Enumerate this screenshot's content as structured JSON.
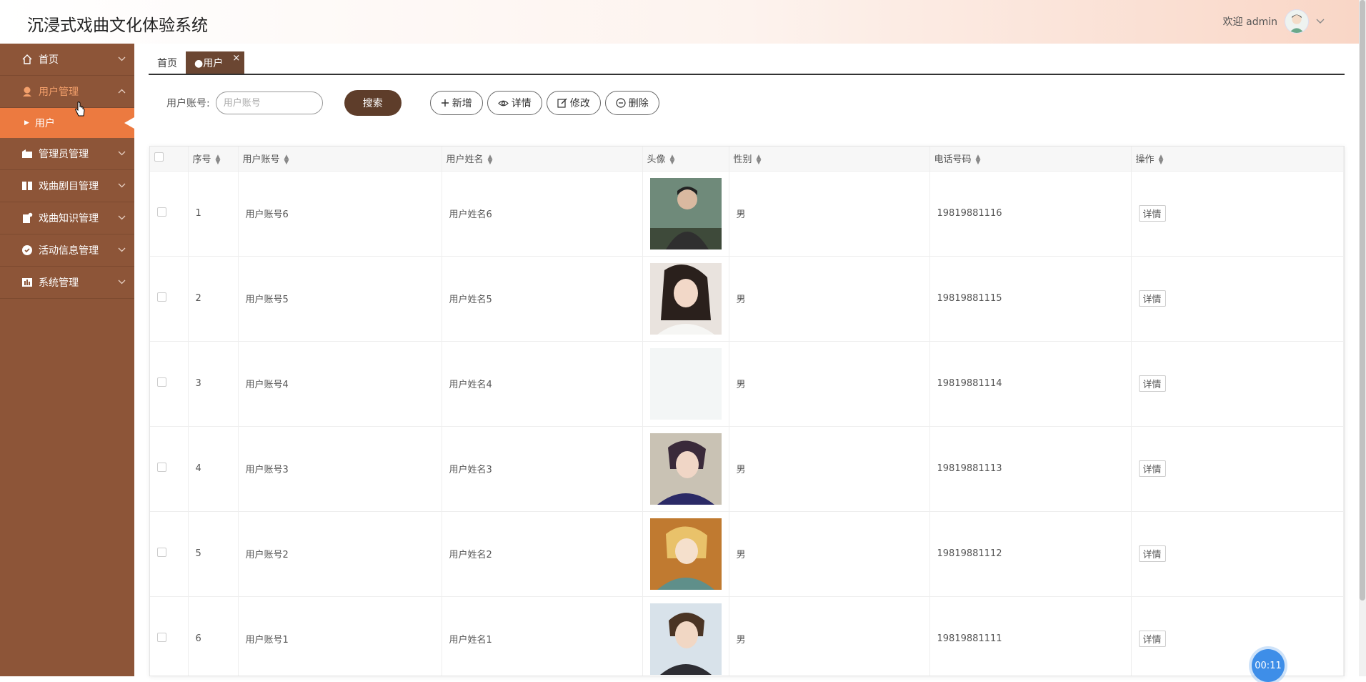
{
  "header": {
    "title": "沉浸式戏曲文化体验系统",
    "welcome": "欢迎 admin"
  },
  "sidebar": {
    "items": [
      {
        "label": "首页",
        "icon": "home-icon"
      },
      {
        "label": "用户管理",
        "icon": "user-icon",
        "active": true,
        "sub": [
          {
            "label": "用户"
          }
        ]
      },
      {
        "label": "管理员管理",
        "icon": "folder-icon"
      },
      {
        "label": "戏曲剧目管理",
        "icon": "book-icon"
      },
      {
        "label": "戏曲知识管理",
        "icon": "document-icon"
      },
      {
        "label": "活动信息管理",
        "icon": "check-circle-icon"
      },
      {
        "label": "系统管理",
        "icon": "chart-icon"
      }
    ]
  },
  "tabs": [
    {
      "label": "首页"
    },
    {
      "label": "●用户",
      "close": "×"
    }
  ],
  "search": {
    "label": "用户账号:",
    "placeholder": "用户账号",
    "button": "搜索"
  },
  "actions": {
    "add": "新增",
    "detail": "详情",
    "edit": "修改",
    "delete": "删除"
  },
  "table": {
    "headers": [
      "序号",
      "用户账号",
      "用户姓名",
      "头像",
      "性别",
      "电话号码",
      "操作"
    ],
    "rows": [
      {
        "no": "1",
        "account": "用户账号6",
        "name": "用户姓名6",
        "gender": "男",
        "phone": "19819881116",
        "action": "详情"
      },
      {
        "no": "2",
        "account": "用户账号5",
        "name": "用户姓名5",
        "gender": "男",
        "phone": "19819881115",
        "action": "详情"
      },
      {
        "no": "3",
        "account": "用户账号4",
        "name": "用户姓名4",
        "gender": "男",
        "phone": "19819881114",
        "action": "详情"
      },
      {
        "no": "4",
        "account": "用户账号3",
        "name": "用户姓名3",
        "gender": "男",
        "phone": "19819881113",
        "action": "详情"
      },
      {
        "no": "5",
        "account": "用户账号2",
        "name": "用户姓名2",
        "gender": "男",
        "phone": "19819881112",
        "action": "详情"
      },
      {
        "no": "6",
        "account": "用户账号1",
        "name": "用户姓名1",
        "gender": "男",
        "phone": "19819881111",
        "action": "详情"
      }
    ]
  },
  "timer": "00:11",
  "colors": {
    "sidebar": "#8d5538",
    "submenu_active": "#ec7a40",
    "menu_active_text": "#f4a06b",
    "search_button": "#5e3d2a",
    "tab_active": "#6b4632",
    "timer": "#3e8ee8"
  }
}
